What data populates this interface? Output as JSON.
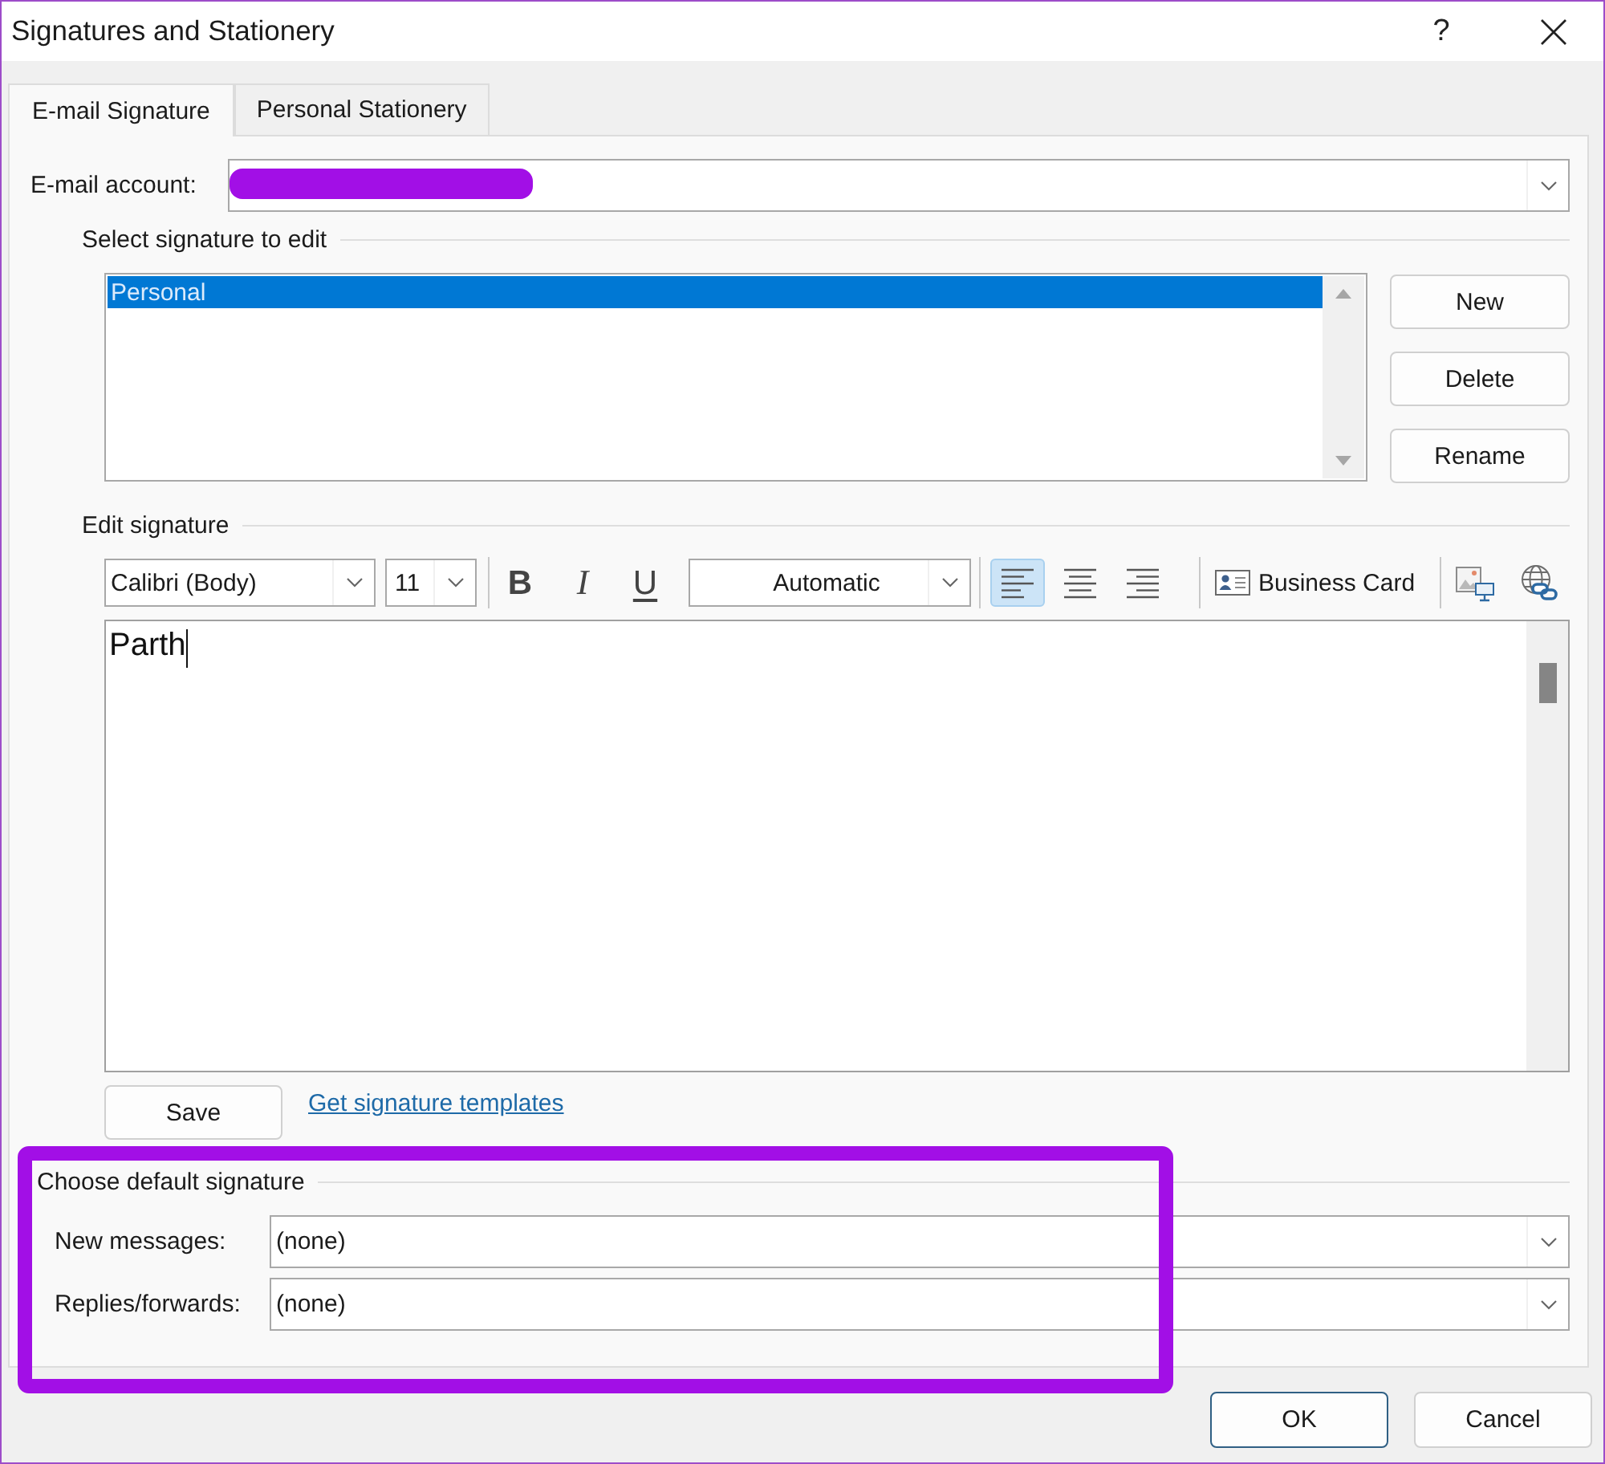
{
  "window": {
    "title": "Signatures and Stationery",
    "help": "?"
  },
  "tabs": [
    {
      "label": "E-mail Signature",
      "selected": true
    },
    {
      "label": "Personal Stationery",
      "selected": false
    }
  ],
  "email_account": {
    "label": "E-mail account:"
  },
  "select_signature": {
    "heading": "Select signature to edit",
    "items": [
      {
        "label": "Personal",
        "selected": true
      }
    ],
    "buttons": [
      "New",
      "Delete",
      "Rename"
    ]
  },
  "edit_signature": {
    "heading": "Edit signature",
    "font": "Calibri (Body)",
    "size": "11",
    "format_buttons": [
      {
        "kind": "bold",
        "label": "B"
      },
      {
        "kind": "italic",
        "label": "I"
      },
      {
        "kind": "underline",
        "label": "U"
      }
    ],
    "font_color_choice": "Automatic",
    "alignments": [
      {
        "kind": "left",
        "selected": true
      },
      {
        "kind": "center",
        "selected": false
      },
      {
        "kind": "right",
        "selected": false
      }
    ],
    "business_card": "Business Card",
    "text": "Parth",
    "save": "Save",
    "templates_link": "Get signature templates"
  },
  "default_signature": {
    "heading": "Choose default signature",
    "fields": [
      {
        "label": "New messages:",
        "value": "(none)"
      },
      {
        "label": "Replies/forwards:",
        "value": "(none)"
      }
    ]
  },
  "footer_buttons": [
    {
      "label": "OK",
      "default": true
    },
    {
      "label": "Cancel",
      "default": false
    }
  ]
}
